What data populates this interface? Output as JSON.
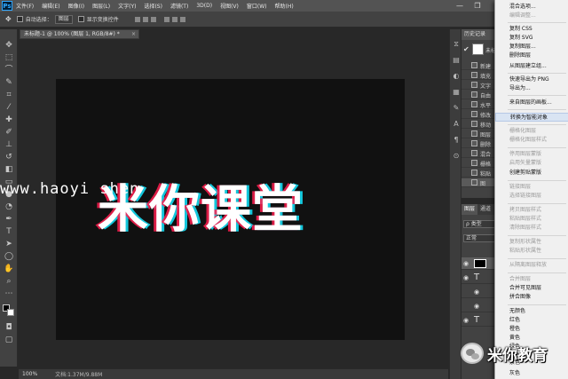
{
  "app": {
    "logo": "Ps"
  },
  "menubar": {
    "items": [
      "文件(F)",
      "编辑(E)",
      "图像(I)",
      "图层(L)",
      "文字(Y)",
      "选择(S)",
      "滤镜(T)",
      "3D(D)",
      "视图(V)",
      "窗口(W)",
      "帮助(H)"
    ],
    "window_controls": {
      "minimize": "—",
      "restore": "❐"
    }
  },
  "options_bar": {
    "auto_select_label": "自动选择：",
    "auto_select_value": "图层",
    "show_transform_label": "显示变换控件"
  },
  "document": {
    "tab_label": "未标题-1 @ 100% (图层 1, RGB/8#) *",
    "close": "×"
  },
  "canvas": {
    "title_text": "米你课堂",
    "watermark": "www.haoyi  shen"
  },
  "statusbar": {
    "zoom": "100%",
    "doc_info": "文档:1.37M/9.88M"
  },
  "history_panel": {
    "tab": "历史记录",
    "snapshot_label": "未标题-1",
    "rows": [
      "新建",
      "填充",
      "文字",
      "自由",
      "水平",
      "修改",
      "移动",
      "图层",
      "删除",
      "混合",
      "栅格",
      "粘贴",
      "图"
    ]
  },
  "layers_panel": {
    "tabs": [
      "图层",
      "通道"
    ],
    "filter": "ρ 类型",
    "blend_mode": "正常"
  },
  "context_menu": {
    "items": [
      {
        "label": "混合选项...",
        "state": "enabled"
      },
      {
        "label": "编辑调整...",
        "state": "disabled"
      },
      {
        "label": "复制 CSS",
        "state": "enabled"
      },
      {
        "label": "复制 SVG",
        "state": "enabled"
      },
      {
        "label": "复制图层...",
        "state": "enabled"
      },
      {
        "label": "删除图层",
        "state": "enabled"
      },
      {
        "label": "从图层建立组...",
        "state": "enabled"
      },
      {
        "label": "快速导出为 PNG",
        "state": "enabled"
      },
      {
        "label": "导出为...",
        "state": "enabled"
      },
      {
        "label": "来自图层的画板...",
        "state": "enabled"
      },
      {
        "label": "转换为智能对象",
        "state": "highlighted"
      },
      {
        "label": "栅格化图层",
        "state": "disabled"
      },
      {
        "label": "栅格化图层样式",
        "state": "disabled"
      },
      {
        "label": "停用图层蒙版",
        "state": "disabled"
      },
      {
        "label": "启用矢量蒙版",
        "state": "disabled"
      },
      {
        "label": "创建剪贴蒙版",
        "state": "enabled"
      },
      {
        "label": "链接图层",
        "state": "disabled"
      },
      {
        "label": "选择链接图层",
        "state": "disabled"
      },
      {
        "label": "拷贝图层样式",
        "state": "disabled"
      },
      {
        "label": "粘贴图层样式",
        "state": "disabled"
      },
      {
        "label": "清除图层样式",
        "state": "disabled"
      },
      {
        "label": "复制形状属性",
        "state": "disabled"
      },
      {
        "label": "粘贴形状属性",
        "state": "disabled"
      },
      {
        "label": "从隔离图层释放",
        "state": "disabled"
      },
      {
        "label": "合并图层",
        "state": "disabled"
      },
      {
        "label": "合并可见图层",
        "state": "enabled"
      },
      {
        "label": "拼合图像",
        "state": "enabled"
      },
      {
        "label": "无颜色",
        "state": "enabled"
      },
      {
        "label": "红色",
        "state": "enabled"
      },
      {
        "label": "橙色",
        "state": "enabled"
      },
      {
        "label": "黄色",
        "state": "enabled"
      },
      {
        "label": "绿色",
        "state": "enabled"
      },
      {
        "label": "紫色",
        "state": "enabled"
      },
      {
        "label": "灰色",
        "state": "enabled"
      }
    ]
  },
  "brand": {
    "name": "米你教育"
  },
  "colors": {
    "canvas_bg": "#111111",
    "text_red_shift": "#ff1e50",
    "text_cyan_shift": "#14e6ff",
    "menu_bg": "#f0f0f0",
    "menu_highlight": "#d9e4f3"
  }
}
